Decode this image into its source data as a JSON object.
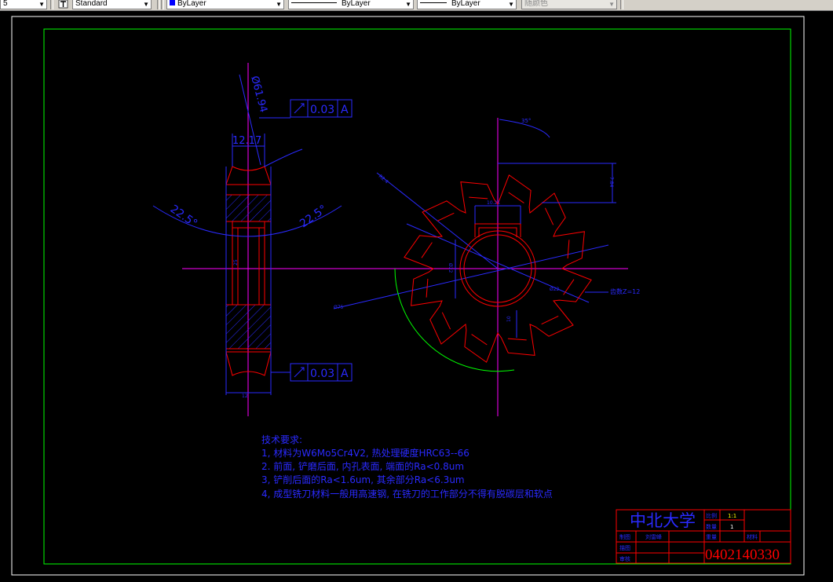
{
  "toolbar": {
    "first_combo": "5",
    "text_style": "Standard",
    "color": "ByLayer",
    "linetype": "ByLayer",
    "lineweight": "ByLayer",
    "plotstyle": "随颜色"
  },
  "colors": {
    "red": "#ff0000",
    "blue": "#2a2aff",
    "magenta": "#ff00ff",
    "green": "#00ff00",
    "white": "#ffffff",
    "yellow": "#ffff00"
  },
  "drawing": {
    "dims": {
      "diameter": "Ø61.94",
      "width_top": "12.17",
      "angle_left": "22.5°",
      "angle_right": "22.5°",
      "tolerance_value": "0.03",
      "tolerance_datum": "A",
      "front_angle": "35°",
      "r_small": "R2.4",
      "keyway_width": "10.21",
      "dim_side": "7.84",
      "bore_dia": "Ø22",
      "hole_dia": "Ø22",
      "outer_dia": "Ø75",
      "teeth_count": "齿数Z=12",
      "bottom_width": "12",
      "center_height": "10",
      "mid_dim": "25"
    },
    "notes": {
      "heading": "技术要求:",
      "line1": "1, 材料为W6Mo5Cr4V2, 热处理硬度HRC63--66",
      "line2": "2. 前面, 铲磨后面, 内孔表面, 端面的Ra<0.8um",
      "line3": "3, 铲削后面的Ra<1.6um, 其余部分Ra<6.3um",
      "line4": "4, 成型铣刀材料一般用高速钢, 在铣刀的工作部分不得有脱碳层和软点"
    },
    "title_block": {
      "school": "中北大学",
      "scale_label": "比例",
      "scale_value": "1:1",
      "qty_label": "数量",
      "qty_value": "1",
      "weight_label": "重量",
      "material_label": "材料",
      "drawn_label": "制图",
      "drawn_name": "刘雷峰",
      "design_label": "描图",
      "check_label": "审核",
      "drawing_number": "0402140330"
    }
  }
}
